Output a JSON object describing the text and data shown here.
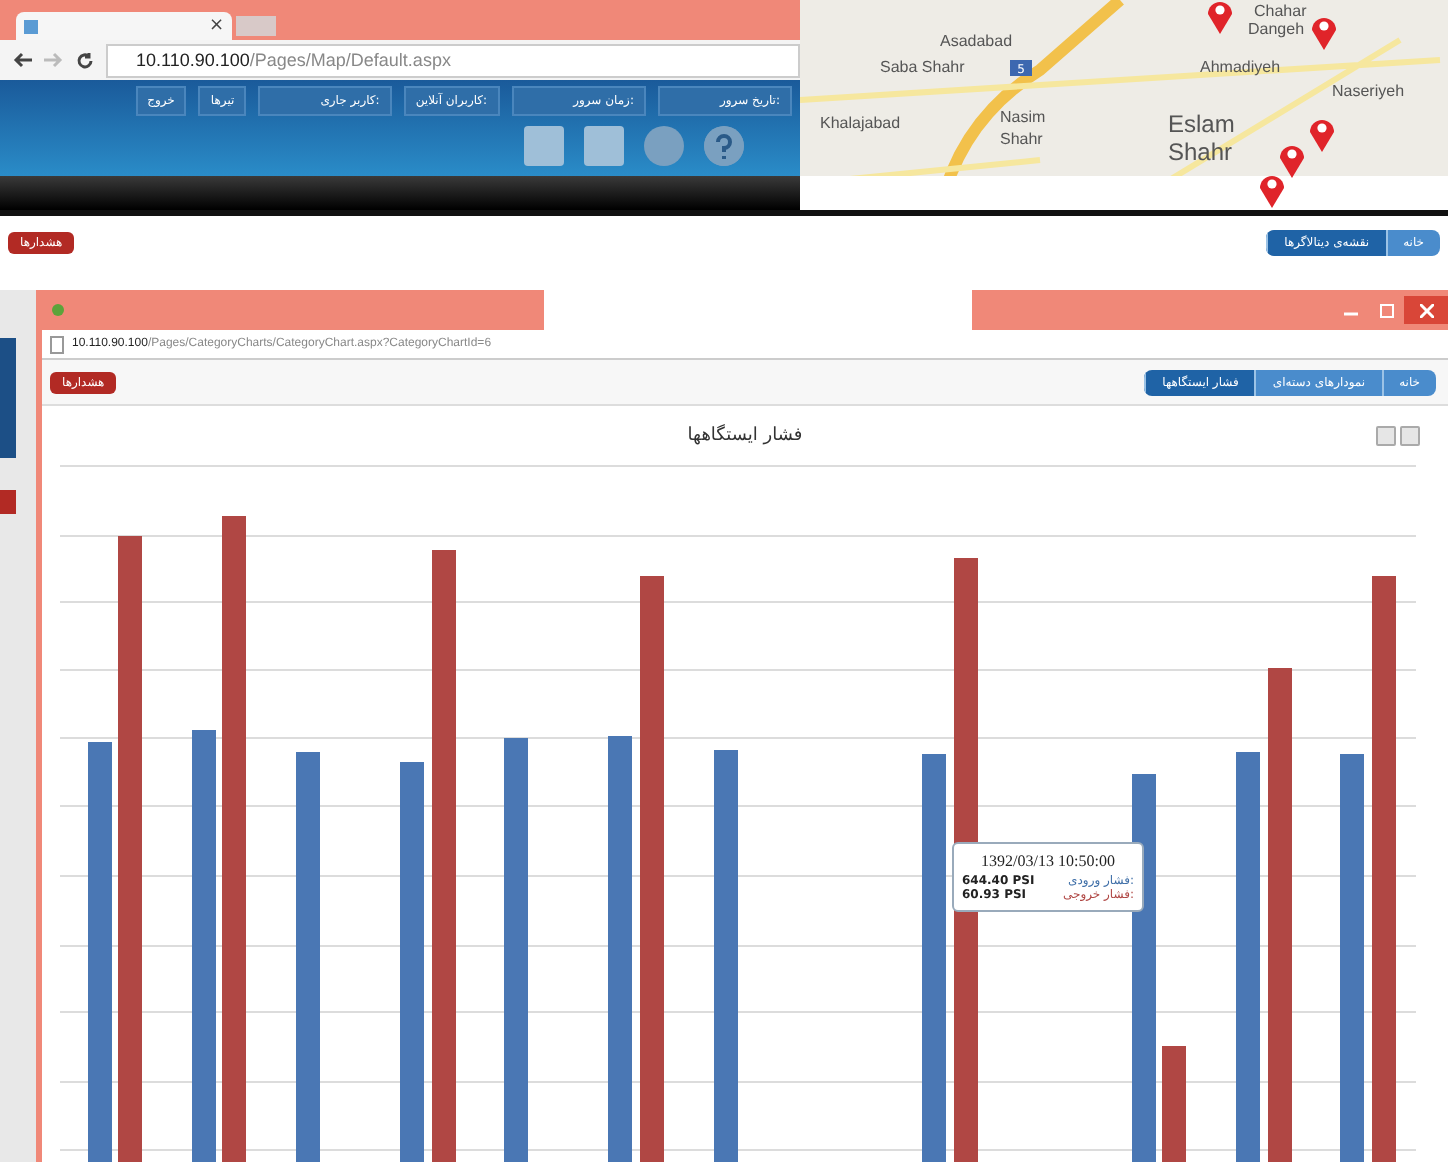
{
  "map_browser": {
    "tab_close": "×",
    "address": {
      "host": "10.110.90.100",
      "path": "/Pages/Map/Default.aspx"
    },
    "header_buttons": [
      "تاریخ سرور:",
      "زمان سرور:",
      "کاربران آنلاین:",
      "کاربر جاری:",
      "تیرها",
      "خروج"
    ]
  },
  "map": {
    "road_shield": "5",
    "labels": [
      "Chahar",
      "Dangeh",
      "Asadabad",
      "Saba Shahr",
      "Ahmadiyeh",
      "Naseriyeh",
      "Khalajabad",
      "Nasim",
      "Shahr",
      "Eslam",
      "Shahr"
    ]
  },
  "page": {
    "alarm_button": "هشدارها",
    "breadcrumb": [
      {
        "label": "خانه",
        "selected": false
      },
      {
        "label": "نقشه‌ی دیتالاگرها",
        "selected": true
      }
    ]
  },
  "chart_window": {
    "address": {
      "host": "10.110.90.100",
      "path": "/Pages/CategoryCharts/CategoryChart.aspx?CategoryChartId=6"
    },
    "alarm_button": "هشدارها",
    "breadcrumb": [
      {
        "label": "خانه",
        "selected": false
      },
      {
        "label": "نمودارهای دسته‌ای",
        "selected": false
      },
      {
        "label": "فشار ایستگاهها",
        "selected": true
      }
    ],
    "chart_title": "فشار ایستگاهها",
    "tooltip": {
      "time": "1392/03/13 10:50:00",
      "rows": [
        {
          "value": "644.40 PSI",
          "label": "فشار ورودی:",
          "color": "#3f6fa8"
        },
        {
          "value": "60.93 PSI",
          "label": "فشار خروجی:",
          "color": "#b04744"
        }
      ]
    }
  }
}
